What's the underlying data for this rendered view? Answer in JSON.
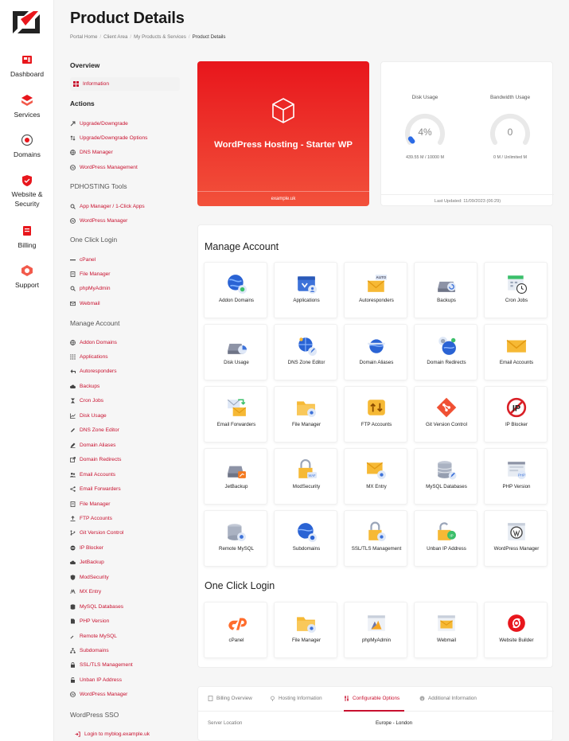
{
  "page": {
    "title": "Product Details"
  },
  "breadcrumb": [
    "Portal Home",
    "Client Area",
    "My Products & Services",
    "Product Details"
  ],
  "rail": [
    {
      "label": "Dashboard",
      "icon": "dashboard-icon"
    },
    {
      "label": "Services",
      "icon": "services-icon"
    },
    {
      "label": "Domains",
      "icon": "domains-icon"
    },
    {
      "label": "Website & Security",
      "icon": "website-security-icon"
    },
    {
      "label": "Billing",
      "icon": "billing-icon"
    },
    {
      "label": "Support",
      "icon": "support-icon"
    }
  ],
  "sidebar": {
    "overview": {
      "heading": "Overview",
      "items": [
        "Information"
      ]
    },
    "actions": {
      "heading": "Actions",
      "items": [
        "Upgrade/Downgrade",
        "Upgrade/Downgrade Options",
        "DNS Manager",
        "WordPress Management"
      ]
    },
    "pdhosting": {
      "heading": "PDHOSTING Tools",
      "items": [
        "App Manager / 1-Click Apps",
        "WordPress Manager"
      ]
    },
    "oneclick": {
      "heading": "One Click Login",
      "items": [
        "cPanel",
        "File Manager",
        "phpMyAdmin",
        "Webmail"
      ]
    },
    "manage": {
      "heading": "Manage Account",
      "items": [
        "Addon Domains",
        "Applications",
        "Autoresponders",
        "Backups",
        "Cron Jobs",
        "Disk Usage",
        "DNS Zone Editor",
        "Domain Aliases",
        "Domain Redirects",
        "Email Accounts",
        "Email Forwarders",
        "File Manager",
        "FTP Accounts",
        "Git Version Control",
        "IP Blocker",
        "JetBackup",
        "ModSecurity",
        "MX Entry",
        "MySQL Databases",
        "PHP Version",
        "Remote MySQL",
        "Subdomains",
        "SSL/TLS Management",
        "Unban IP Address",
        "WordPress Manager"
      ]
    },
    "sso": {
      "heading": "WordPress SSO",
      "items": [
        "Login to myblog.example.uk"
      ]
    }
  },
  "hero": {
    "product": "WordPress Hosting - Starter WP",
    "domain": "example.uk"
  },
  "usage": {
    "disk": {
      "label": "Disk Usage",
      "percent": 4,
      "value_text": "4%",
      "detail": "439.55 M / 10000 M"
    },
    "bandwidth": {
      "label": "Bandwidth Usage",
      "percent": 0,
      "value_text": "0",
      "detail": "0 M / Unlimited M"
    },
    "last_updated": "Last Updated: 11/09/2023 (06:29)"
  },
  "manage": {
    "heading": "Manage Account",
    "tiles": [
      "Addon Domains",
      "Applications",
      "Autoresponders",
      "Backups",
      "Cron Jobs",
      "Disk Usage",
      "DNS Zone Editor",
      "Domain Aliases",
      "Domain Redirects",
      "Email Accounts",
      "Email Forwarders",
      "File Manager",
      "FTP Accounts",
      "Git Version Control",
      "IP Blocker",
      "JetBackup",
      "ModSecurity",
      "MX Entry",
      "MySQL Databases",
      "PHP Version",
      "Remote MySQL",
      "Subdomains",
      "SSL/TLS Management",
      "Unban IP Address",
      "WordPress Manager"
    ]
  },
  "oneclick": {
    "heading": "One Click Login",
    "tiles": [
      "cPanel",
      "File Manager",
      "phpMyAdmin",
      "Webmail",
      "Website Builder"
    ]
  },
  "tabs": {
    "items": [
      "Billing Overview",
      "Hosting Information",
      "Configurable Options",
      "Additional Information"
    ],
    "active": "Configurable Options",
    "row_key": "Server Location",
    "row_value": "Europe - London"
  },
  "colors": {
    "accent": "#c8102e",
    "hero_top": "#e8161c",
    "hero_bottom": "#f2513b"
  },
  "icon_autoresponder_badge": "AUTO",
  "icon_ip_text": "IP"
}
